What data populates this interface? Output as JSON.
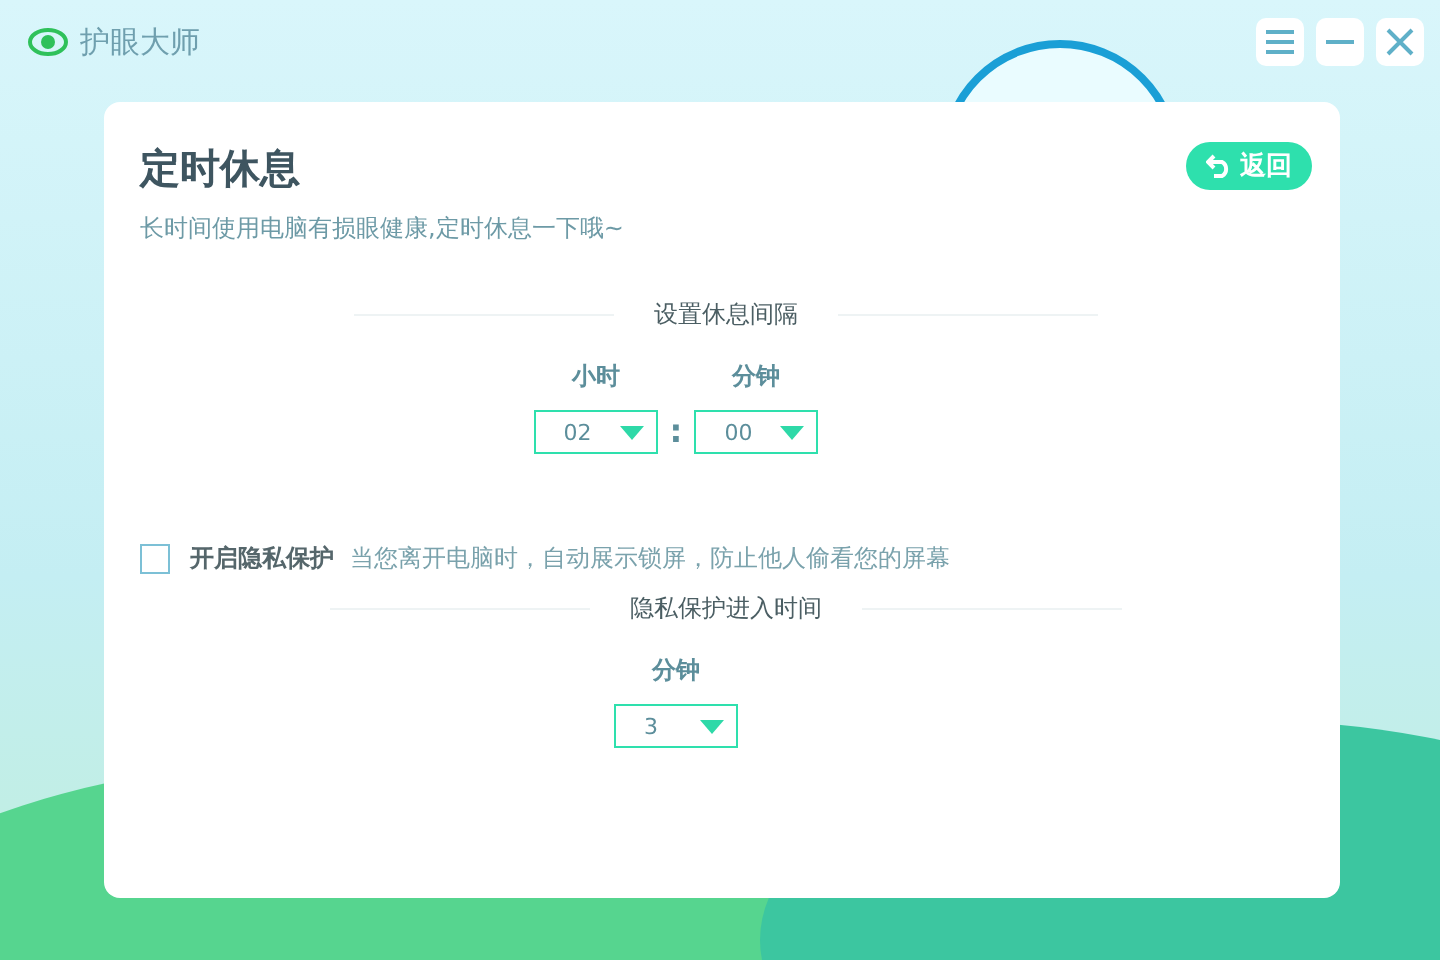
{
  "app": {
    "title": "护眼大师"
  },
  "page": {
    "title": "定时休息",
    "subtitle": "长时间使用电脑有损眼健康,定时休息一下哦~",
    "back_button": "返回"
  },
  "interval": {
    "heading": "设置休息间隔",
    "separator": ":",
    "fields": [
      {
        "label": "小时",
        "value": "02"
      },
      {
        "label": "分钟",
        "value": "00"
      }
    ]
  },
  "privacy": {
    "checked": false,
    "label": "开启隐私保护",
    "description": "当您离开电脑时，自动展示锁屏，防止他人偷看您的屏幕",
    "heading": "隐私保护进入时间",
    "field": {
      "label": "分钟",
      "value": "3"
    }
  }
}
